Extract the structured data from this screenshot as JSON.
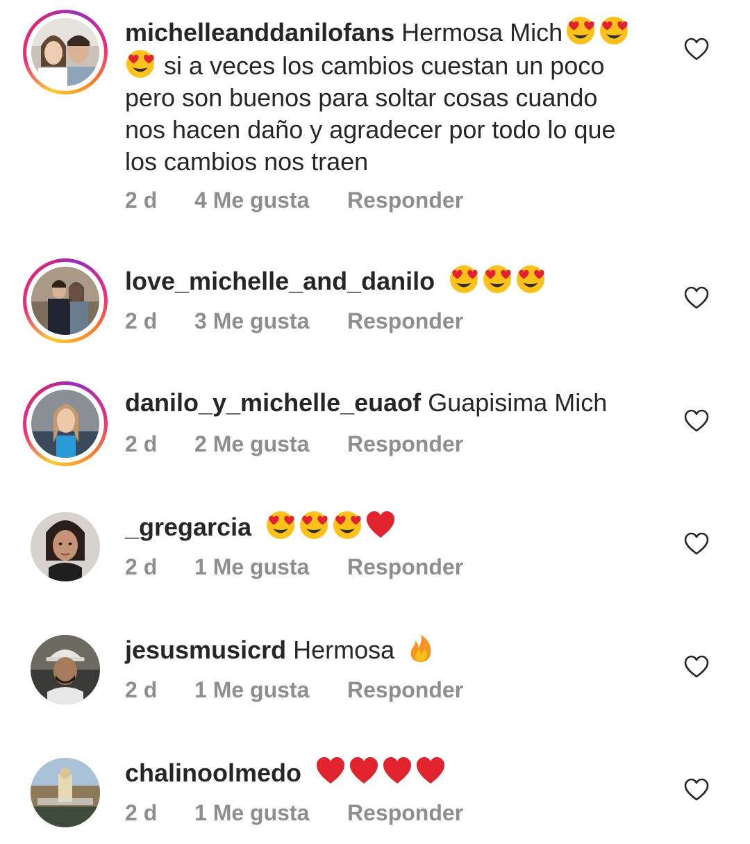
{
  "comments": [
    {
      "username": "michelleanddanilofans",
      "text_lines": [
        "Hermosa Mich",
        "si a veces los cambios cuestan un poco",
        "pero son buenos para soltar cosas cuando",
        "nos hacen daño y agradecer por todo lo que",
        "los cambios nos traen"
      ],
      "emojis_after_first_line": [
        "heart-eyes-emoji",
        "heart-eyes-emoji"
      ],
      "emojis_start_second_line": [
        "heart-eyes-emoji"
      ],
      "time": "2 d",
      "likes": "4 Me gusta",
      "reply": "Responder",
      "has_story_ring": true
    },
    {
      "username": "love_michelle_and_danilo",
      "text": "",
      "emojis": [
        "heart-eyes-emoji",
        "heart-eyes-emoji",
        "heart-eyes-emoji"
      ],
      "time": "2 d",
      "likes": "3 Me gusta",
      "reply": "Responder",
      "has_story_ring": true
    },
    {
      "username": "danilo_y_michelle_euaof",
      "text": "Guapisima Mich",
      "emojis": [],
      "time": "2 d",
      "likes": "2 Me gusta",
      "reply": "Responder",
      "has_story_ring": true
    },
    {
      "username": "_gregarcia",
      "text": "",
      "emojis": [
        "heart-eyes-emoji",
        "heart-eyes-emoji",
        "heart-eyes-emoji",
        "red-heart-emoji"
      ],
      "time": "2 d",
      "likes": "1 Me gusta",
      "reply": "Responder",
      "has_story_ring": false
    },
    {
      "username": "jesusmusicrd",
      "text": "Hermosa",
      "emojis": [
        "fire-emoji"
      ],
      "time": "2 d",
      "likes": "1 Me gusta",
      "reply": "Responder",
      "has_story_ring": false
    },
    {
      "username": "chalinoolmedo",
      "text": "",
      "emojis": [
        "red-heart-emoji",
        "red-heart-emoji",
        "red-heart-emoji",
        "red-heart-emoji"
      ],
      "time": "2 d",
      "likes": "1 Me gusta",
      "reply": "Responder",
      "has_story_ring": false
    }
  ],
  "colors": {
    "text": "#262626",
    "meta": "#8e8e8e",
    "like_icon_stroke": "#262626",
    "heart_emoji": "#e0232e",
    "emoji_face": "#fcc21b"
  },
  "icons": {
    "like": "heart-outline-icon"
  }
}
